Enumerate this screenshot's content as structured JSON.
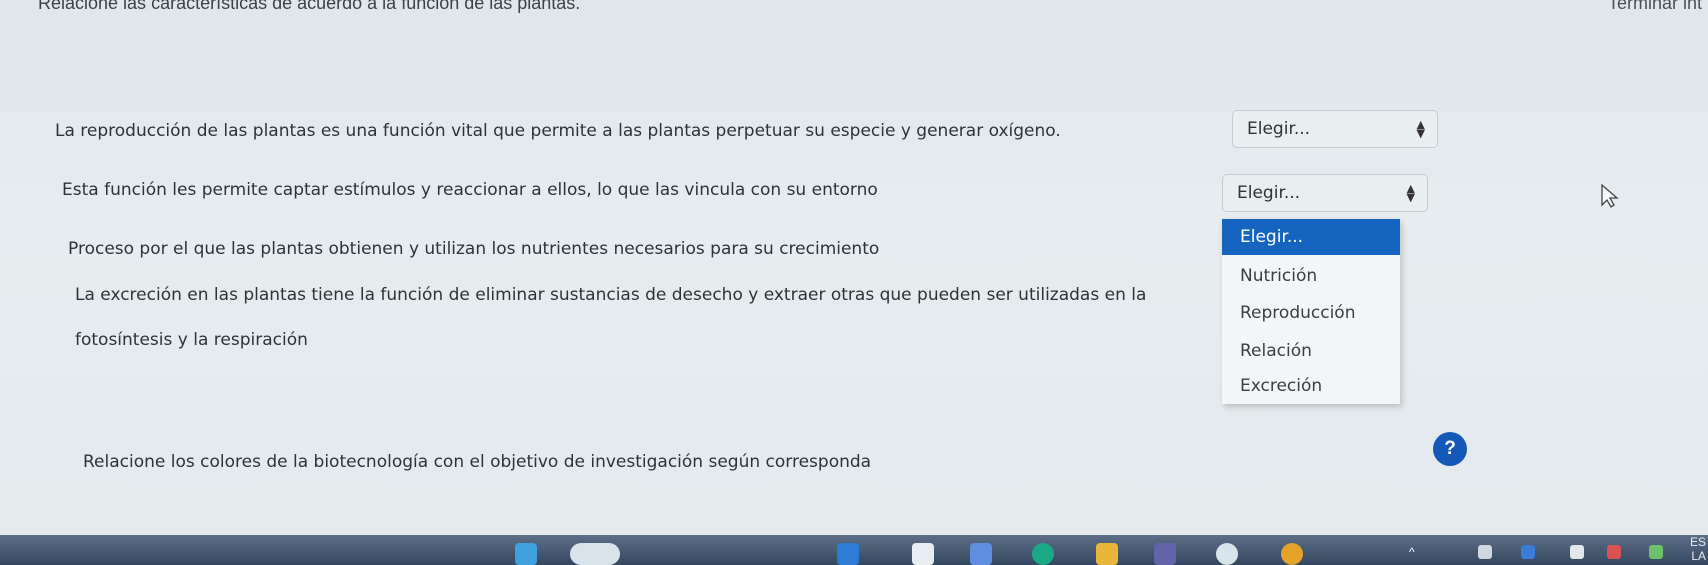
{
  "header": {
    "title": "Relacione las características de acuerdo a la función de las plantas.",
    "finish_link": "Terminar int"
  },
  "questions": [
    {
      "text": "La reproducción de las plantas es una función vital que permite a las plantas perpetuar su especie y generar oxígeno.",
      "selected": "Elegir..."
    },
    {
      "text": "Esta función les permite captar estímulos y reaccionar a ellos, lo que las vincula con su entorno",
      "selected": "Elegir..."
    },
    {
      "text": "Proceso por el que las plantas obtienen y utilizan los nutrientes necesarios para su crecimiento",
      "selected": "Elegir..."
    },
    {
      "text_line1": "La excreción en las plantas tiene la función de eliminar sustancias de desecho y extraer otras que pueden ser utilizadas en la",
      "text_line2": "fotosíntesis y la respiración"
    }
  ],
  "dropdown": {
    "options": [
      "Elegir...",
      "Nutrición",
      "Reproducción",
      "Relación",
      "Excreción"
    ],
    "highlighted": "Elegir..."
  },
  "next_question": {
    "text": "Relacione los colores de la biotecnología con el objetivo de investigación según corresponda"
  },
  "help_button": {
    "label": "?"
  },
  "taskbar": {
    "language_line1": "ES",
    "language_line2": "LA",
    "icons": [
      "start-icon",
      "search-icon",
      "widgets-icon",
      "browser-icon",
      "store-icon",
      "edge-icon",
      "file-explorer-icon",
      "teams-icon",
      "whatsapp-icon",
      "chrome-icon"
    ],
    "tray_icons": [
      "chevron-up-icon",
      "network-icon",
      "battery-icon",
      "volume-icon",
      "wifi-icon"
    ]
  },
  "colors": {
    "accent": "#1565c0",
    "help_button": "#1458b8",
    "background": "#e3e9ec",
    "taskbar": "#3d506a"
  }
}
